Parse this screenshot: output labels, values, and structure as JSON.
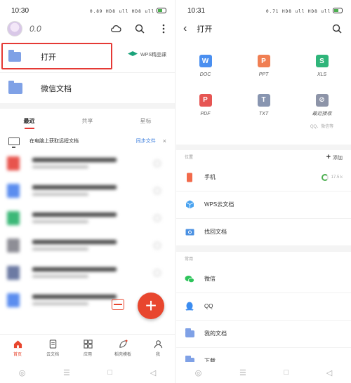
{
  "left": {
    "status": {
      "time": "10:30",
      "icons": "0.89 HD8 ull HD8 ull"
    },
    "user": {
      "name": "0.0"
    },
    "open_label": "打开",
    "wps_course": "WPS精品课",
    "wechat_docs": "微信文档",
    "tabs": [
      "最近",
      "共享",
      "星标"
    ],
    "pc_prompt": "在电脑上获取远程文档",
    "pc_sync": "同步文件",
    "pc_close": "×",
    "doc_colors": [
      "#e8544d",
      "#5b8def",
      "#3cb878",
      "#8e8e96",
      "#6c7aa3",
      "#5b8def"
    ],
    "bottom_nav": [
      "首页",
      "云文档",
      "应用",
      "稻壳模板",
      "我"
    ],
    "accent": "#e8462e"
  },
  "right": {
    "status": {
      "time": "10:31",
      "icons": "0.71 HD8 ull HD8 ull"
    },
    "title": "打开",
    "tiles": [
      {
        "label": "DOC",
        "letter": "W",
        "color": "#4a8ff0"
      },
      {
        "label": "PPT",
        "letter": "P",
        "color": "#f07f53"
      },
      {
        "label": "XLS",
        "letter": "S",
        "color": "#2fb57a"
      },
      {
        "label": "PDF",
        "letter": "P",
        "color": "#e65553"
      },
      {
        "label": "TXT",
        "letter": "T",
        "color": "#8895b0"
      },
      {
        "label": "最近接收",
        "sub": "QQ、微信等",
        "letter": "",
        "color": "#8d94a8"
      }
    ],
    "location_header": "位置",
    "add_label": "添加",
    "locations": [
      {
        "label": "手机",
        "extra": "17.5 k"
      },
      {
        "label": "WPS云文档"
      },
      {
        "label": "找回文档"
      }
    ],
    "common_header": "常用",
    "common": [
      {
        "label": "微信"
      },
      {
        "label": "QQ"
      },
      {
        "label": "我的文档"
      },
      {
        "label": "下载"
      }
    ]
  },
  "system_nav": [
    "◎",
    "☰",
    "□",
    "◁"
  ]
}
